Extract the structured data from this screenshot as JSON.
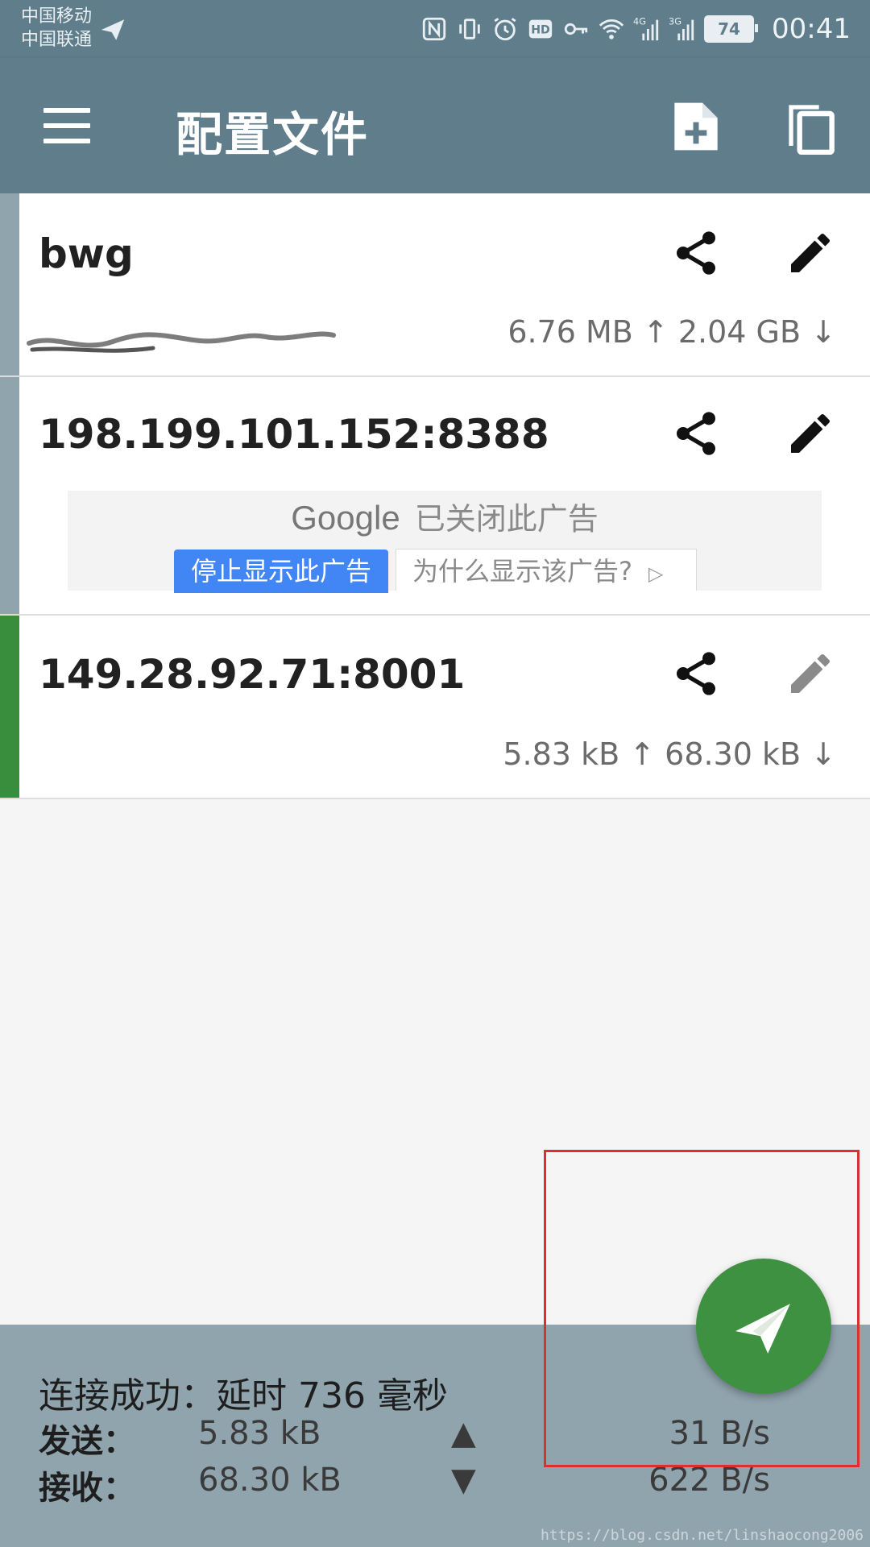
{
  "status_bar": {
    "carrier_1": "中国移动",
    "carrier_2": "中国联通",
    "network_1": "4G",
    "network_2": "3G",
    "battery": "74",
    "time": "00:41"
  },
  "toolbar": {
    "title": "配置文件"
  },
  "profiles": [
    {
      "name": "bwg",
      "traffic": "6.76 MB ↑ 2.04 GB ↓",
      "active": false
    },
    {
      "name": "198.199.101.152:8388",
      "active": false,
      "ad": {
        "brand": "Google",
        "text": "已关闭此广告",
        "stop_label": "停止显示此广告",
        "why_label": "为什么显示该广告?"
      }
    },
    {
      "name": "149.28.92.71:8001",
      "traffic": "5.83 kB ↑  68.30 kB ↓",
      "active": true
    }
  ],
  "stats": {
    "status": "连接成功：延时 736 毫秒",
    "send_label": "发送：",
    "send_total": "5.83 kB",
    "send_arrow": "▲",
    "send_rate": "31 B/s",
    "recv_label": "接收：",
    "recv_total": "68.30 kB",
    "recv_arrow": "▼",
    "recv_rate": "622 B/s"
  },
  "colors": {
    "toolbar": "#607d8b",
    "stats_panel": "#90a4ae",
    "active_stripe": "#388e3c",
    "fab": "#3d9140",
    "highlight": "#d9312f"
  },
  "watermark": "https://blog.csdn.net/linshaocong2006"
}
